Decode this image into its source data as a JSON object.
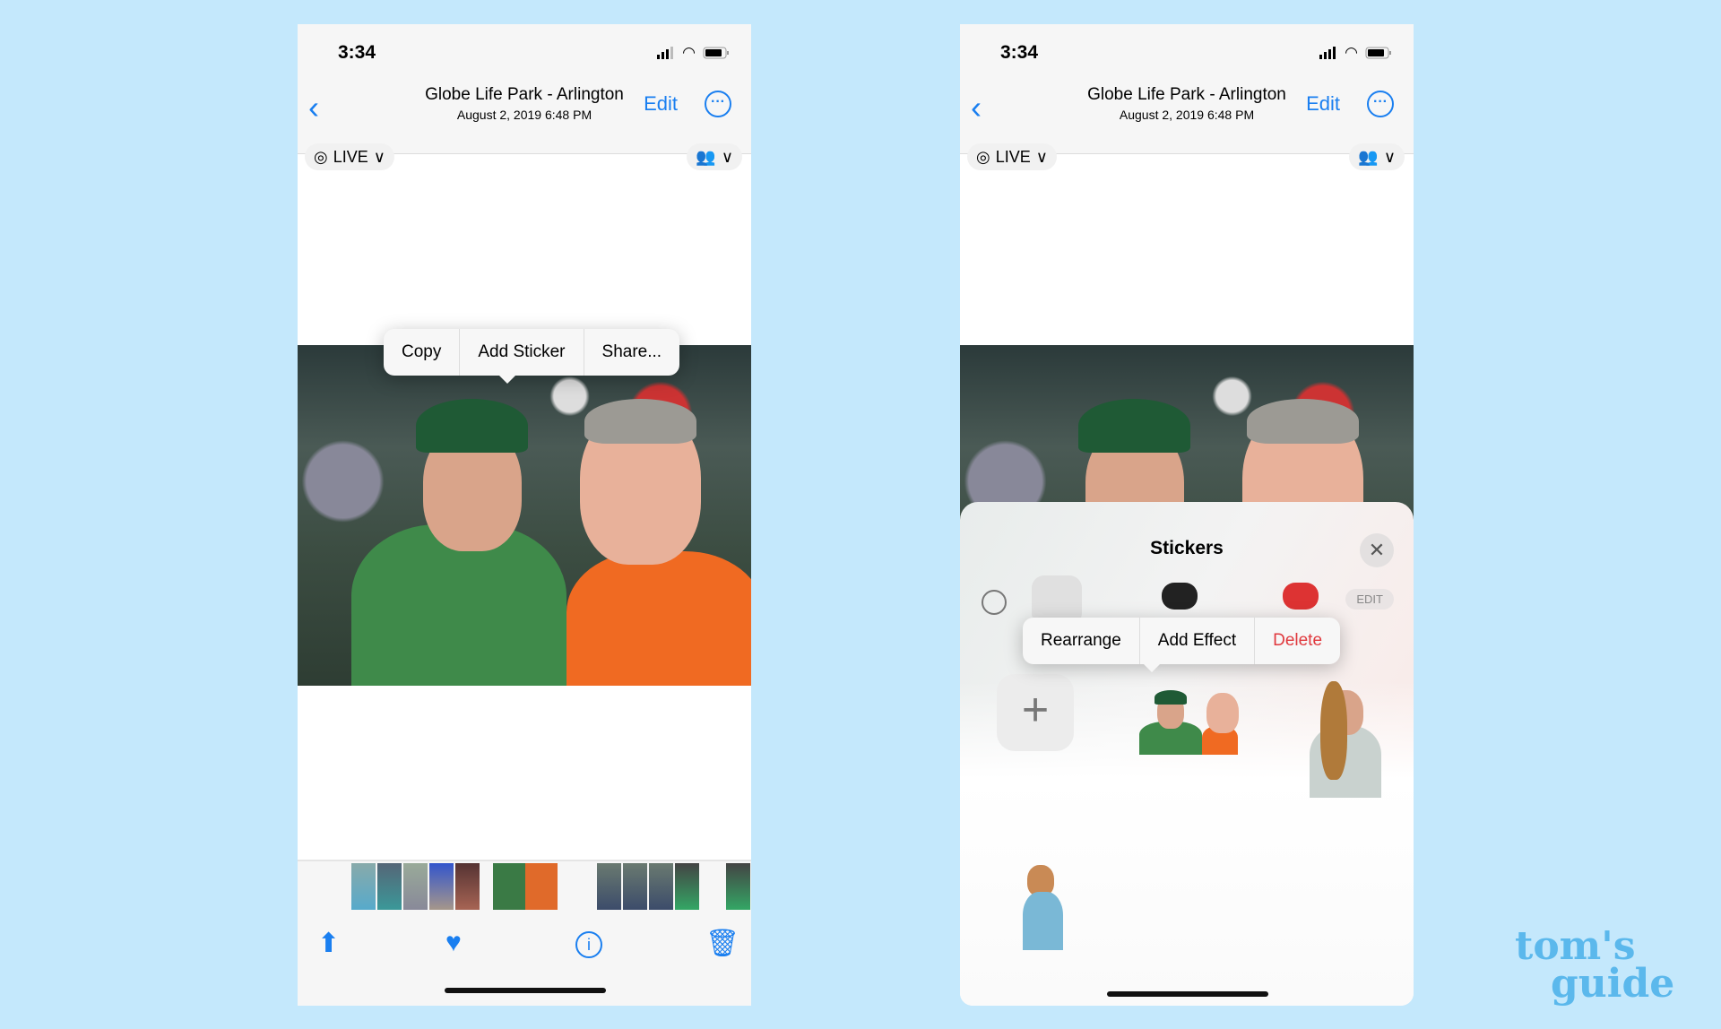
{
  "status": {
    "time": "3:34"
  },
  "nav": {
    "title": "Globe Life Park - Arlington",
    "date": "August 2, 2019  6:48 PM",
    "edit": "Edit"
  },
  "live": {
    "label": "LIVE"
  },
  "copy_menu": {
    "items": [
      "Copy",
      "Add Sticker",
      "Share..."
    ]
  },
  "stickers": {
    "title": "Stickers",
    "edit": "EDIT",
    "menu": [
      "Rearrange",
      "Add Effect",
      "Delete"
    ]
  },
  "colors": {
    "accent": "#1a7ff0",
    "destructive": "#e0393e",
    "background": "#c4e8fc"
  },
  "toolbar": {
    "icons": [
      "share-icon",
      "heart-icon",
      "info-icon",
      "trash-icon"
    ]
  },
  "watermark": {
    "line1": "tom's",
    "line2": "guide"
  }
}
